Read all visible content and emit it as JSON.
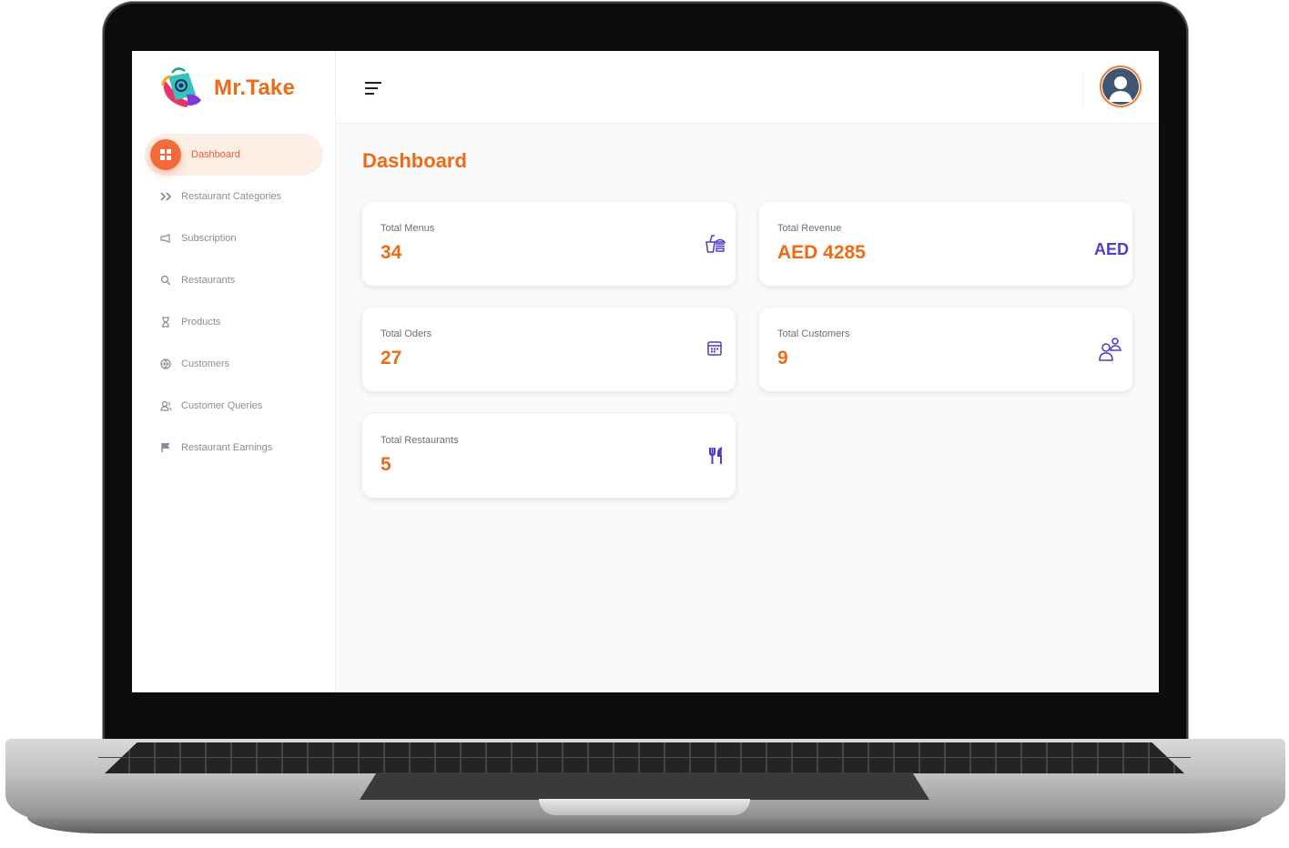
{
  "brand": {
    "name": "Mr.Take"
  },
  "sidebar": {
    "items": [
      {
        "label": "Dashboard",
        "icon": "grid-icon",
        "active": true
      },
      {
        "label": "Restaurant Categories",
        "icon": "double-chevron-right-icon"
      },
      {
        "label": "Subscription",
        "icon": "megaphone-icon"
      },
      {
        "label": "Restaurants",
        "icon": "search-icon"
      },
      {
        "label": "Products",
        "icon": "hourglass-icon"
      },
      {
        "label": "Customers",
        "icon": "globe-icon"
      },
      {
        "label": "Customer Queries",
        "icon": "users-icon"
      },
      {
        "label": "Restaurant Earnings",
        "icon": "flag-icon"
      }
    ]
  },
  "page": {
    "title": "Dashboard"
  },
  "cards": [
    {
      "label": "Total Menus",
      "value": "34",
      "icon": "food-drink-icon"
    },
    {
      "label": "Total Revenue",
      "value": "AED 4285",
      "icon_text": "AED"
    },
    {
      "label": "Total Oders",
      "value": "27",
      "icon": "calendar-icon"
    },
    {
      "label": "Total Customers",
      "value": "9",
      "icon": "customers-icon"
    },
    {
      "label": "Total Restaurants",
      "value": "5",
      "icon": "cutlery-icon"
    }
  ],
  "colors": {
    "accent": "#ee6a14",
    "icon": "#4b3fc6",
    "active_bg": "#fdeee6"
  }
}
